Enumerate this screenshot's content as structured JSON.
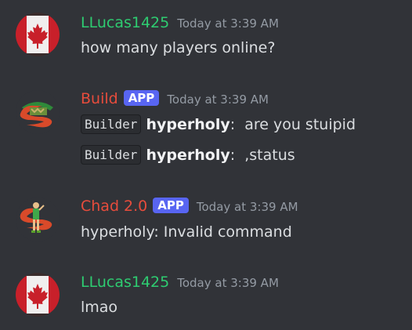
{
  "colors": {
    "background": "#313338",
    "username_llucas": "#2ecc71",
    "username_bot": "#e74c3c",
    "app_tag": "#5865f2",
    "timestamp": "#949ba4"
  },
  "messages": [
    {
      "author": "LLucas1425",
      "avatar_icon": "canada-flag-avatar-icon",
      "timestamp": "Today at 3:39 AM",
      "lines": [
        "how many players online?"
      ]
    },
    {
      "author": "Build",
      "tag": "APP",
      "avatar_icon": "bot-avatar-icon",
      "timestamp": "Today at 3:39 AM",
      "lines": [
        {
          "code": "Builder",
          "name": "hyperholy",
          "text": ":  are you stuipid"
        },
        {
          "code": "Builder",
          "name": "hyperholy",
          "text": ":  ,status"
        }
      ]
    },
    {
      "author": "Chad 2.0",
      "tag": "APP",
      "avatar_icon": "bot-avatar-icon",
      "timestamp": "Today at 3:39 AM",
      "lines": [
        "hyperholy: Invalid command"
      ]
    },
    {
      "author": "LLucas1425",
      "avatar_icon": "canada-flag-avatar-icon",
      "timestamp": "Today at 3:39 AM",
      "lines": [
        "lmao"
      ]
    }
  ]
}
